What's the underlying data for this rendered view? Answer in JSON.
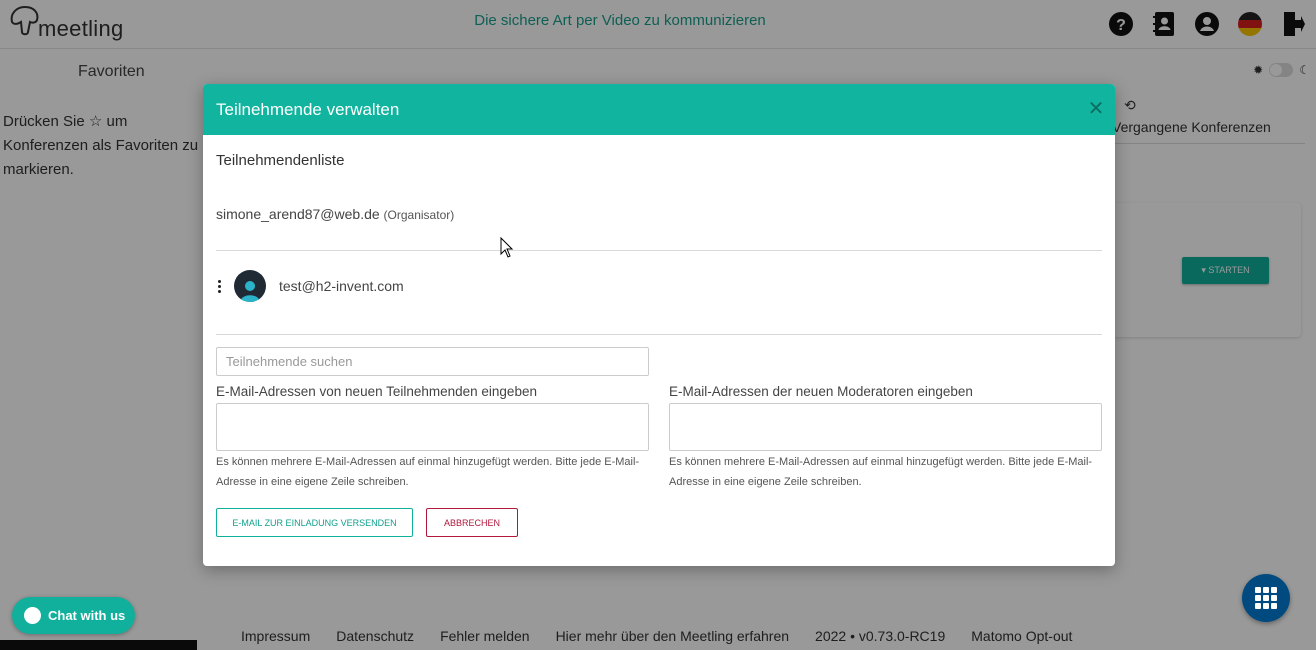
{
  "app": {
    "logo_text": "meetling",
    "tagline": "Die sichere Art per Video zu kommunizieren"
  },
  "header_icons": [
    "help-icon",
    "address-book-icon",
    "user-account-icon",
    "german-flag-icon",
    "logout-icon"
  ],
  "left_panel": {
    "title": "Favoriten",
    "hint_prefix": "Drücken Sie",
    "hint_star": "☆",
    "hint_suffix": "um Konferenzen als Favoriten zu markieren."
  },
  "right_panel": {
    "past_conferences_label": "Vergangene Konferenzen",
    "start_button": "▾ STARTEN"
  },
  "footer": {
    "links": [
      "Impressum",
      "Datenschutz",
      "Fehler melden",
      "Hier mehr über den Meetling erfahren",
      "2022 • v0.73.0-RC19",
      "Matomo Opt-out"
    ],
    "chat_label": "Chat with us"
  },
  "modal": {
    "title": "Teilnehmende verwalten",
    "close_symbol": "✕",
    "list_title": "Teilnehmendenliste",
    "organizer_email": "simone_arend87@web.de",
    "organizer_role": "(Organisator)",
    "participants": [
      {
        "email": "test@h2-invent.com"
      }
    ],
    "search_placeholder": "Teilnehmende suchen",
    "participants_label": "E-Mail-Adressen von neuen Teilnehmenden eingeben",
    "moderators_label": "E-Mail-Adressen der neuen Moderatoren eingeben",
    "help_text": "Es können mehrere E-Mail-Adressen auf einmal hinzugefügt werden. Bitte jede E-Mail-Adresse in eine eigene Zeile schreiben.",
    "send_button": "E-MAIL ZUR EINLADUNG VERSENDEN",
    "cancel_button": "ABBRECHEN"
  },
  "colors": {
    "accent": "#11b59f",
    "danger": "#b0183c",
    "grid_button": "#004a80"
  }
}
